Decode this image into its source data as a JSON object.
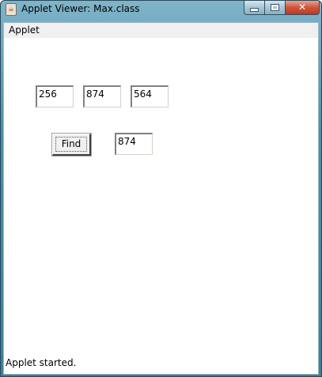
{
  "window": {
    "title": "Applet Viewer: Max.class",
    "minimize_glyph": "",
    "maximize_glyph": "",
    "close_glyph": "✕",
    "app_icon": "java-cup-icon"
  },
  "menubar": {
    "items": [
      {
        "label": "Applet"
      }
    ]
  },
  "applet": {
    "inputs": [
      "256",
      "874",
      "564"
    ],
    "find_label": "Find",
    "result": "874"
  },
  "status": {
    "text": "Applet started."
  }
}
